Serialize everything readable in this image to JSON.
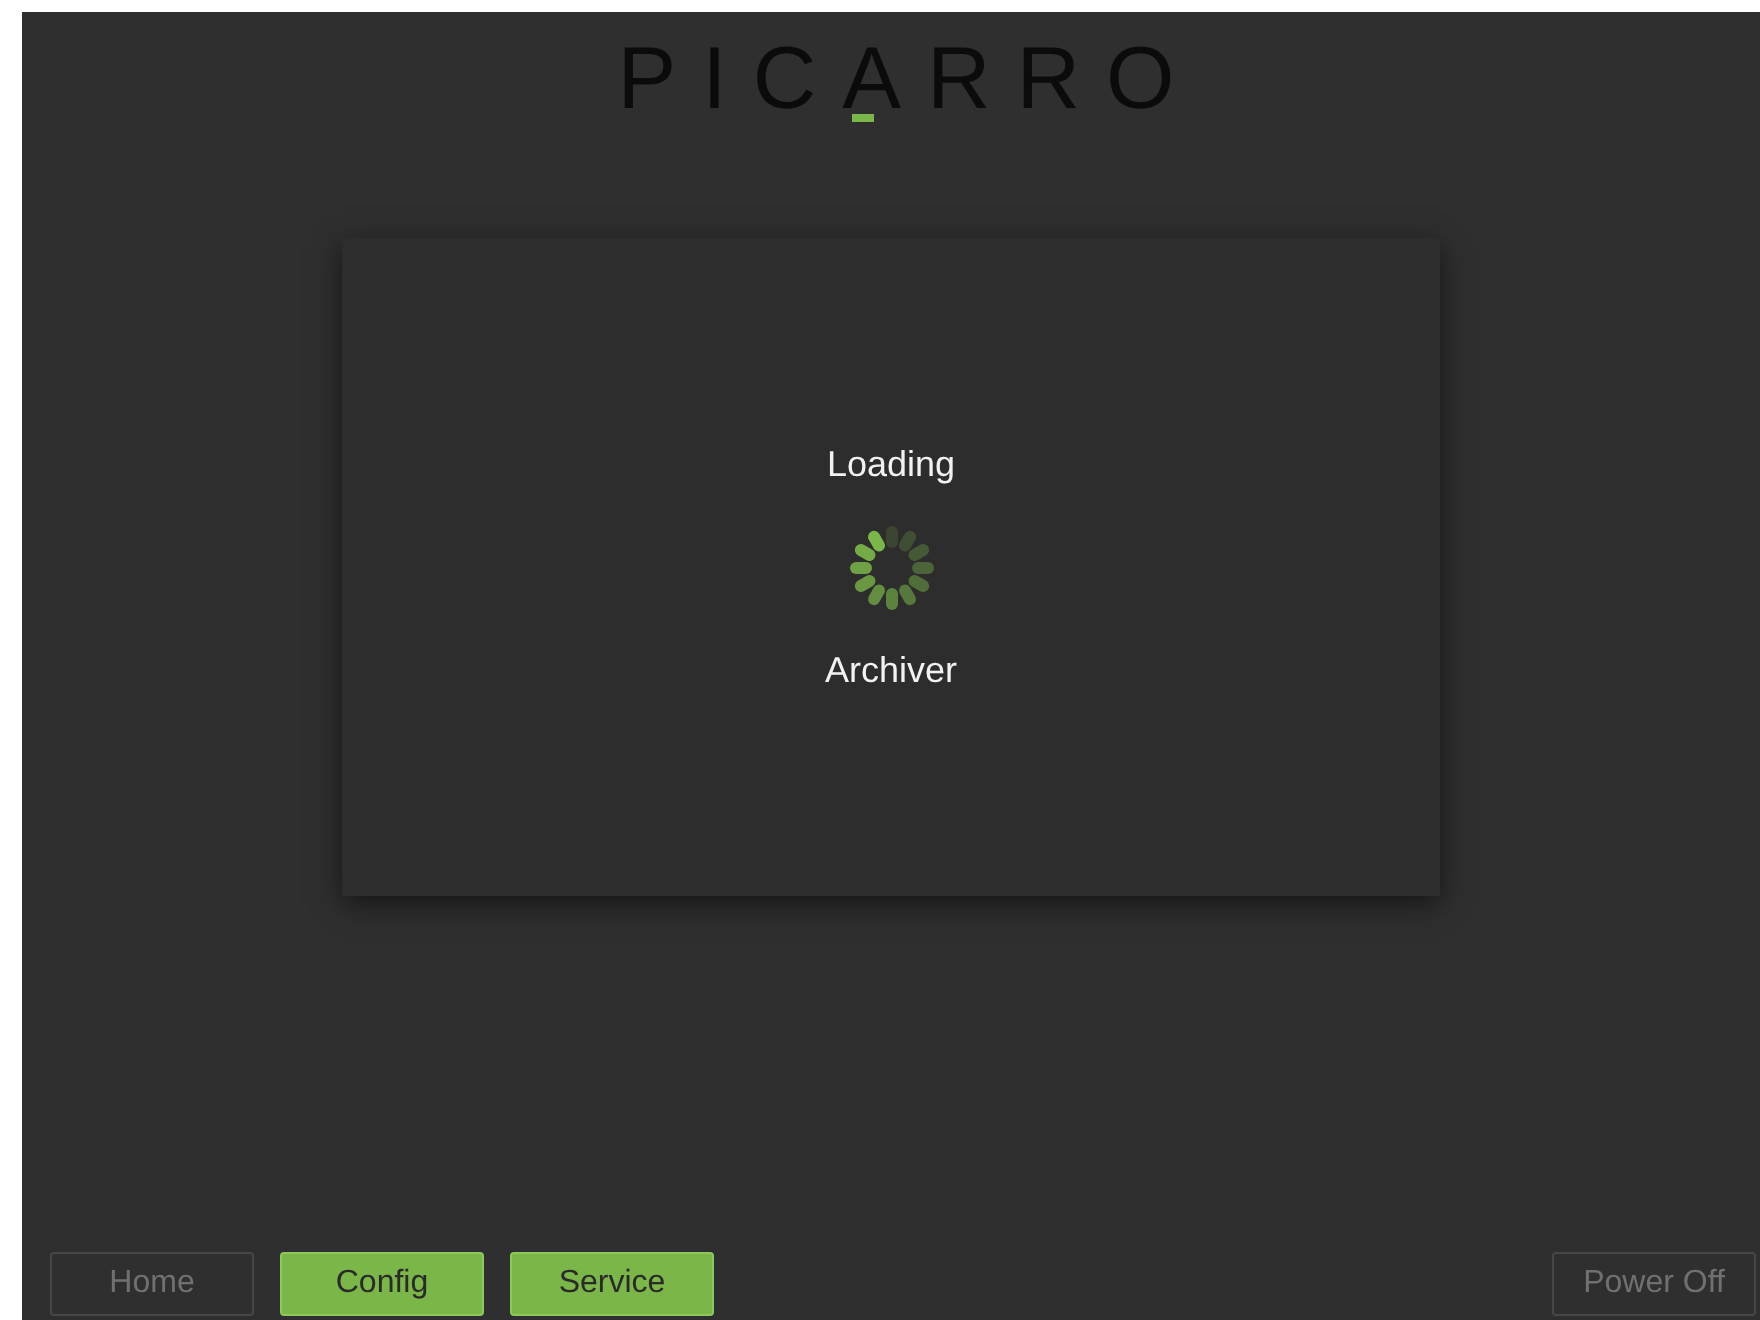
{
  "logo": {
    "text": "PICARRO"
  },
  "dialog": {
    "title": "Loading",
    "subtitle": "Archiver"
  },
  "nav_buttons": [
    {
      "label": "Home",
      "disabled": true
    },
    {
      "label": "Config",
      "disabled": false
    },
    {
      "label": "Service",
      "disabled": false
    }
  ],
  "power_button": {
    "label": "Power Off",
    "disabled": true
  }
}
